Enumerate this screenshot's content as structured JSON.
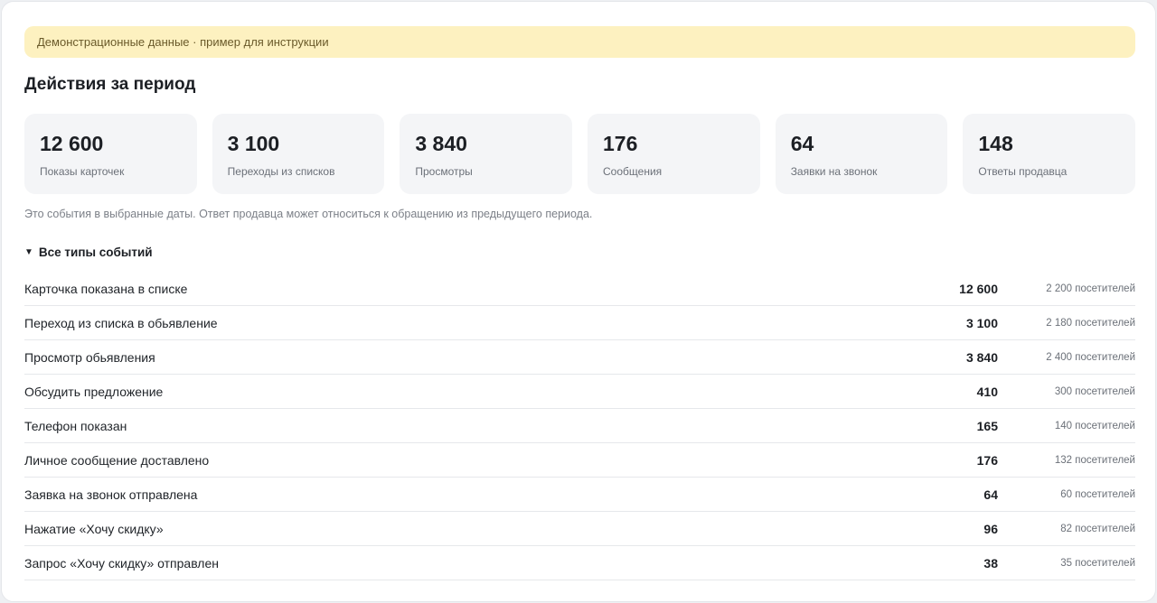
{
  "banner": {
    "text": "Демонстрационные данные · пример для инструкции"
  },
  "section": {
    "title": "Действия за период"
  },
  "stats": [
    {
      "value": "12 600",
      "label": "Показы карточек"
    },
    {
      "value": "3 100",
      "label": "Переходы из списков"
    },
    {
      "value": "3 840",
      "label": "Просмотры"
    },
    {
      "value": "176",
      "label": "Сообщения"
    },
    {
      "value": "64",
      "label": "Заявки на звонок"
    },
    {
      "value": "148",
      "label": "Ответы продавца"
    }
  ],
  "note": "Это события в выбранные даты. Ответ продавца может относиться к обращению из предыдущего периода.",
  "toggle": {
    "icon": "▼",
    "label": "Все типы событий"
  },
  "events": [
    {
      "name": "Карточка показана в списке",
      "count": "12 600",
      "visitors": "2 200 посетителей"
    },
    {
      "name": "Переход из списка в обьявление",
      "count": "3 100",
      "visitors": "2 180 посетителей"
    },
    {
      "name": "Просмотр обьявления",
      "count": "3 840",
      "visitors": "2 400 посетителей"
    },
    {
      "name": "Обсудить предложение",
      "count": "410",
      "visitors": "300 посетителей"
    },
    {
      "name": "Телефон показан",
      "count": "165",
      "visitors": "140 посетителей"
    },
    {
      "name": "Личное сообщение доставлено",
      "count": "176",
      "visitors": "132 посетителей"
    },
    {
      "name": "Заявка на звонок отправлена",
      "count": "64",
      "visitors": "60 посетителей"
    },
    {
      "name": "Нажатие «Хочу скидку»",
      "count": "96",
      "visitors": "82 посетителей"
    },
    {
      "name": "Запрос «Хочу скидку» отправлен",
      "count": "38",
      "visitors": "35 посетителей"
    }
  ]
}
